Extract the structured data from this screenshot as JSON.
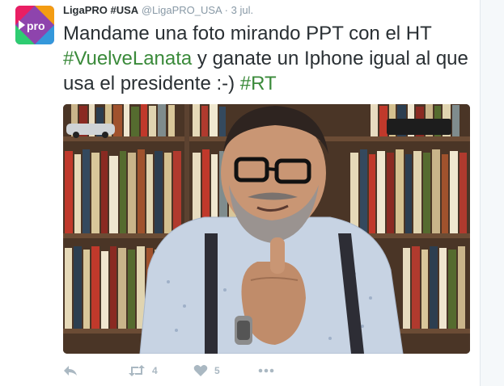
{
  "tweet": {
    "author": {
      "display_name": "LigaPRO #USA",
      "handle": "@LigaPRO_USA",
      "avatar_text": "pro"
    },
    "separator": "·",
    "timestamp": "3 jul.",
    "text_parts": {
      "part1": "Mandame una foto mirando PPT con el HT ",
      "hashtag1": "#VuelveLanata",
      "part2": " y ganate un Iphone igual al que usa el presidente :-) ",
      "hashtag2": "#RT"
    },
    "actions": {
      "reply_icon": "reply-icon",
      "retweet_icon": "retweet-icon",
      "retweet_count": "4",
      "like_icon": "heart-icon",
      "like_count": "5",
      "more_icon": "more-icon"
    }
  },
  "colors": {
    "hashtag": "#3a8a3a",
    "text": "#292f33",
    "muted": "#8899a6",
    "action": "#aab8c2"
  }
}
